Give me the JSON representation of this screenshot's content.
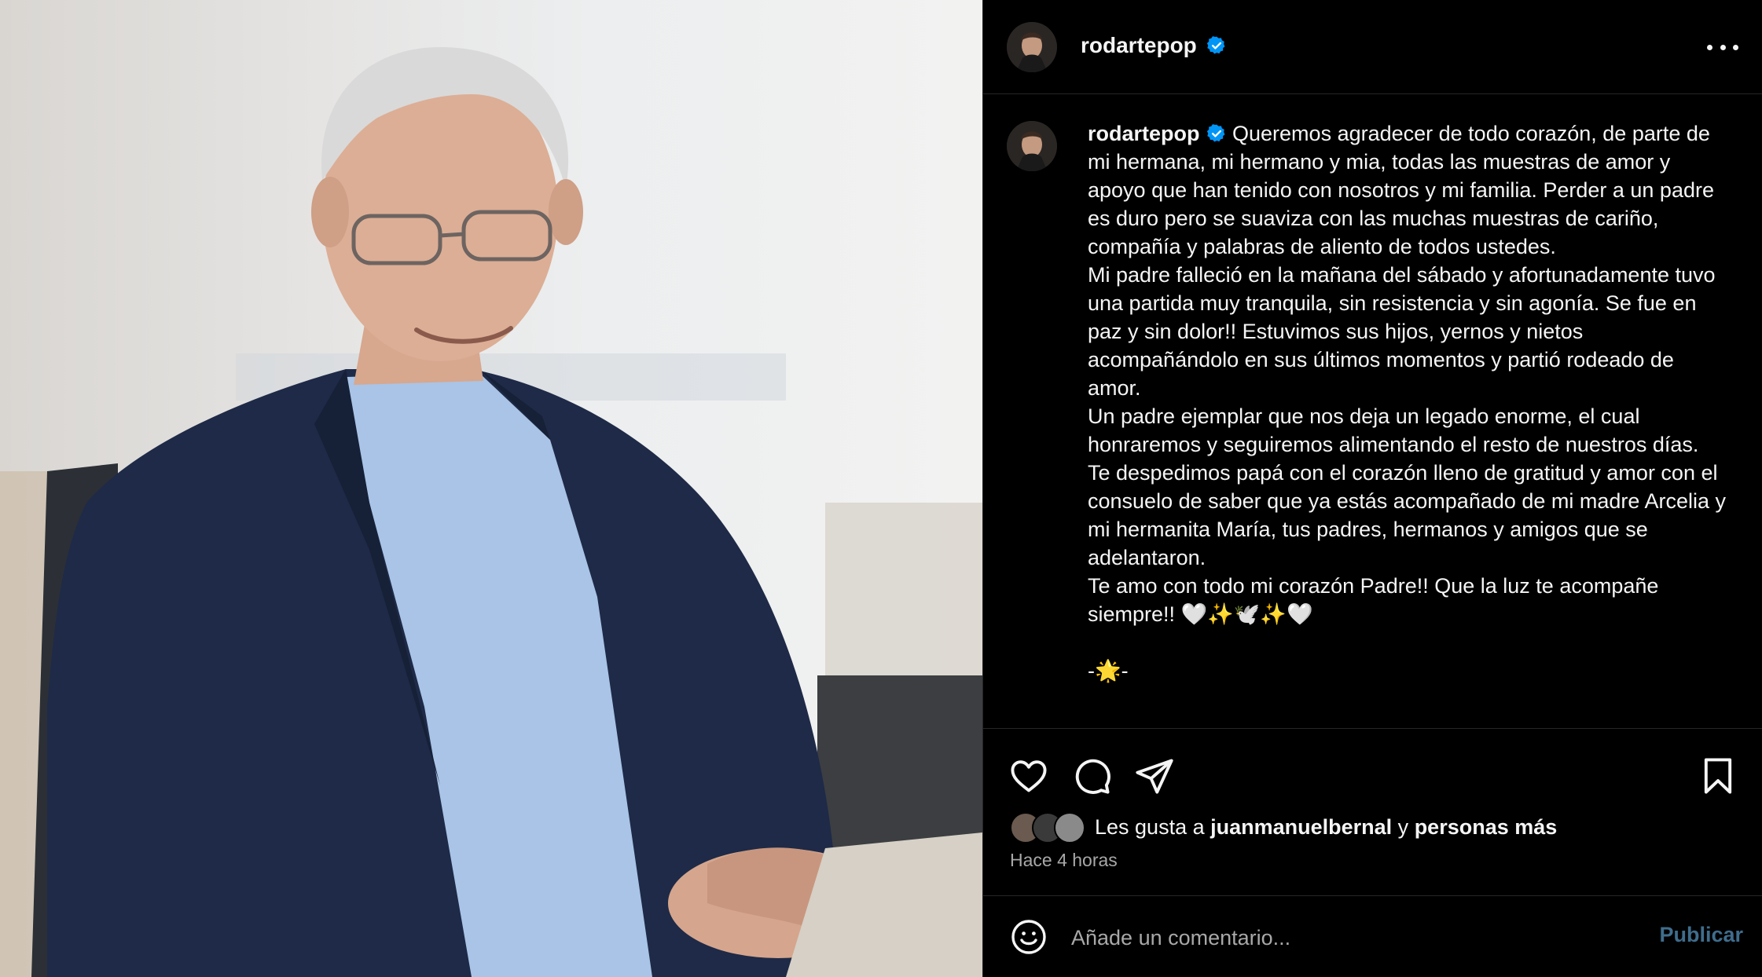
{
  "post": {
    "username": "rodartepop",
    "verified": true,
    "photo_alt": "Portrait of a smiling older man with glasses wearing a navy blazer and light blue shirt"
  },
  "header": {
    "username": "rodartepop",
    "more_icon": "more-horizontal-icon"
  },
  "caption": {
    "username": "rodartepop",
    "text": " Queremos agradecer de todo corazón, de parte de mi hermana, mi hermano y mia, todas las muestras de amor y apoyo que han tenido con nosotros y mi familia. Perder a un padre es duro pero se suaviza con las muchas muestras de cariño, compañía y palabras de aliento de todos ustedes.\nMi padre falleció en la mañana del sábado y afortunadamente tuvo una partida muy tranquila, sin resistencia y sin agonía. Se fue en paz y sin dolor!! Estuvimos sus hijos, yernos y nietos acompañándolo en sus últimos momentos y partió rodeado de amor.\nUn padre ejemplar que nos deja un legado enorme, el cual honraremos y seguiremos alimentando el resto de nuestros días.\nTe despedimos papá con el corazón lleno de gratitud y amor con el consuelo de saber que ya estás acompañado de mi madre Arcelia y mi hermanita María, tus padres, hermanos y amigos que se adelantaron.\nTe amo con todo mi corazón Padre!! Que la luz te acompañe siempre!! 🤍✨🕊️✨🤍\n\n-🌟-"
  },
  "actions": {
    "like_icon": "heart-icon",
    "comment_icon": "comment-icon",
    "share_icon": "send-icon",
    "save_icon": "bookmark-icon"
  },
  "likes": {
    "prefix": "Les gusta a ",
    "user": "juanmanuelbernal",
    "middle": " y ",
    "others": "personas más"
  },
  "timestamp": "Hace 4 horas",
  "comment": {
    "placeholder": "Añade un comentario...",
    "publish_label": "Publicar",
    "emoji_icon": "smiley-icon"
  },
  "colors": {
    "background": "#000000",
    "text": "#f5f5f5",
    "secondary": "#a8a8a8",
    "verified": "#0095f6",
    "publish_disabled": "#3f6d8c",
    "divider": "#262626"
  }
}
